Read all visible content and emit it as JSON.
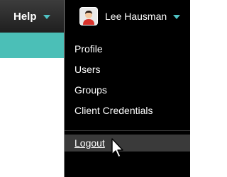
{
  "nav": {
    "help_label": "Help",
    "user_name": "Lee Hausman"
  },
  "menu": {
    "items": [
      {
        "label": "Profile"
      },
      {
        "label": "Users"
      },
      {
        "label": "Groups"
      },
      {
        "label": "Client Credentials"
      }
    ],
    "logout_label": "Logout"
  },
  "colors": {
    "accent": "#4bbfb7",
    "caret": "#4fc3c4",
    "menu_bg": "#000000",
    "topbar": "#2a2a2a"
  },
  "icons": {
    "avatar": "user-avatar-icon",
    "caret": "chevron-down-icon",
    "cursor": "mouse-pointer-icon"
  }
}
